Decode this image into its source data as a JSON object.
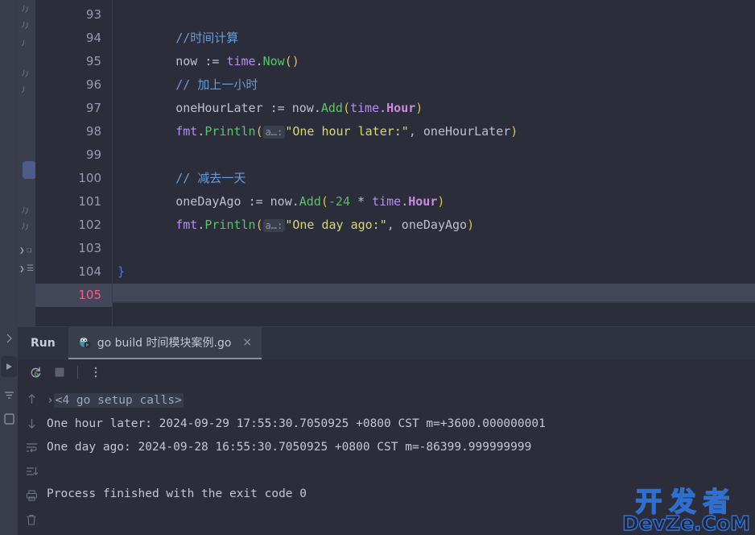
{
  "editor": {
    "lines": [
      {
        "num": "93",
        "tokens": []
      },
      {
        "num": "94",
        "tokens": [
          {
            "t": "comment",
            "v": "        //时间计算"
          }
        ]
      },
      {
        "num": "95",
        "tokens": [
          {
            "t": "plain",
            "v": "        now "
          },
          {
            "t": "op",
            "v": ":= "
          },
          {
            "t": "pkg",
            "v": "time"
          },
          {
            "t": "plain",
            "v": "."
          },
          {
            "t": "fn",
            "v": "Now"
          },
          {
            "t": "paren",
            "v": "()"
          }
        ]
      },
      {
        "num": "96",
        "tokens": [
          {
            "t": "comment",
            "v": "        // 加上一小时"
          }
        ]
      },
      {
        "num": "97",
        "tokens": [
          {
            "t": "plain",
            "v": "        oneHourLater "
          },
          {
            "t": "op",
            "v": ":= "
          },
          {
            "t": "plain",
            "v": "now."
          },
          {
            "t": "fn",
            "v": "Add"
          },
          {
            "t": "paren",
            "v": "("
          },
          {
            "t": "pkg",
            "v": "time"
          },
          {
            "t": "plain",
            "v": "."
          },
          {
            "t": "const",
            "v": "Hour"
          },
          {
            "t": "paren",
            "v": ")"
          }
        ]
      },
      {
        "num": "98",
        "tokens": [
          {
            "t": "plain",
            "v": "        "
          },
          {
            "t": "pkg",
            "v": "fmt"
          },
          {
            "t": "plain",
            "v": "."
          },
          {
            "t": "fn",
            "v": "Println"
          },
          {
            "t": "paren",
            "v": "("
          },
          {
            "t": "hint",
            "v": "a…:"
          },
          {
            "t": "str",
            "v": "\"One hour later:\""
          },
          {
            "t": "plain",
            "v": ", oneHourLater"
          },
          {
            "t": "paren",
            "v": ")"
          }
        ]
      },
      {
        "num": "99",
        "tokens": []
      },
      {
        "num": "100",
        "tokens": [
          {
            "t": "comment",
            "v": "        // 减去一天"
          }
        ]
      },
      {
        "num": "101",
        "tokens": [
          {
            "t": "plain",
            "v": "        oneDayAgo "
          },
          {
            "t": "op",
            "v": ":= "
          },
          {
            "t": "plain",
            "v": "now."
          },
          {
            "t": "fn",
            "v": "Add"
          },
          {
            "t": "paren",
            "v": "("
          },
          {
            "t": "num",
            "v": "-24"
          },
          {
            "t": "plain",
            "v": " * "
          },
          {
            "t": "pkg",
            "v": "time"
          },
          {
            "t": "plain",
            "v": "."
          },
          {
            "t": "const",
            "v": "Hour"
          },
          {
            "t": "paren",
            "v": ")"
          }
        ]
      },
      {
        "num": "102",
        "tokens": [
          {
            "t": "plain",
            "v": "        "
          },
          {
            "t": "pkg",
            "v": "fmt"
          },
          {
            "t": "plain",
            "v": "."
          },
          {
            "t": "fn",
            "v": "Println"
          },
          {
            "t": "paren",
            "v": "("
          },
          {
            "t": "hint",
            "v": "a…:"
          },
          {
            "t": "str",
            "v": "\"One day ago:\""
          },
          {
            "t": "plain",
            "v": ", oneDayAgo"
          },
          {
            "t": "paren",
            "v": ")"
          }
        ]
      },
      {
        "num": "103",
        "tokens": []
      },
      {
        "num": "104",
        "tokens": [
          {
            "t": "brace",
            "v": "}"
          }
        ]
      },
      {
        "num": "105",
        "tokens": [],
        "current": true
      }
    ],
    "current_line_number": "105"
  },
  "run_panel": {
    "title": "Run",
    "tab": {
      "label": "go build 时间模块案例.go",
      "icon": "go-gopher-icon",
      "close_label": "×"
    },
    "toolbar": {
      "rerun": "rerun-icon",
      "stop": "stop-icon",
      "more": "more-options-icon"
    },
    "side_icons": [
      "scroll-up-icon",
      "scroll-down-icon",
      "soft-wrap-icon",
      "scroll-to-end-icon",
      "print-icon",
      "clear-all-icon"
    ],
    "stripe_icons": [
      "hide-icon",
      "run-active-icon",
      "filter-icon",
      "terminal-icon"
    ],
    "console": {
      "folded_line": "<4 go setup calls>",
      "fold_caret": "›",
      "lines": [
        "One hour later: 2024-09-29 17:55:30.7050925 +0800 CST m=+3600.000000001",
        "One day ago: 2024-09-28 16:55:30.7050925 +0800 CST m=-86399.999999999",
        "",
        "Process finished with the exit code 0"
      ]
    }
  },
  "watermark": {
    "line1": "开发者",
    "line2": "DevZe.CoM"
  },
  "colors": {
    "editor_bg": "#2b2d3a",
    "gutter_bg": "#2b2d3a",
    "current_line": "#434759",
    "comment": "#6a9cd4",
    "string": "#d7d77a",
    "function": "#59c46a",
    "package": "#b48ef0",
    "paren": "#d9c04a",
    "number": "#63b36c",
    "brace": "#5c6fe0",
    "line_number": "#969ab0",
    "current_line_number": "#ef5f8c",
    "tab_active_bg": "#3a3d4c",
    "stripe_bg": "#393c4b",
    "watermark_stroke": "#2f6fd0"
  }
}
